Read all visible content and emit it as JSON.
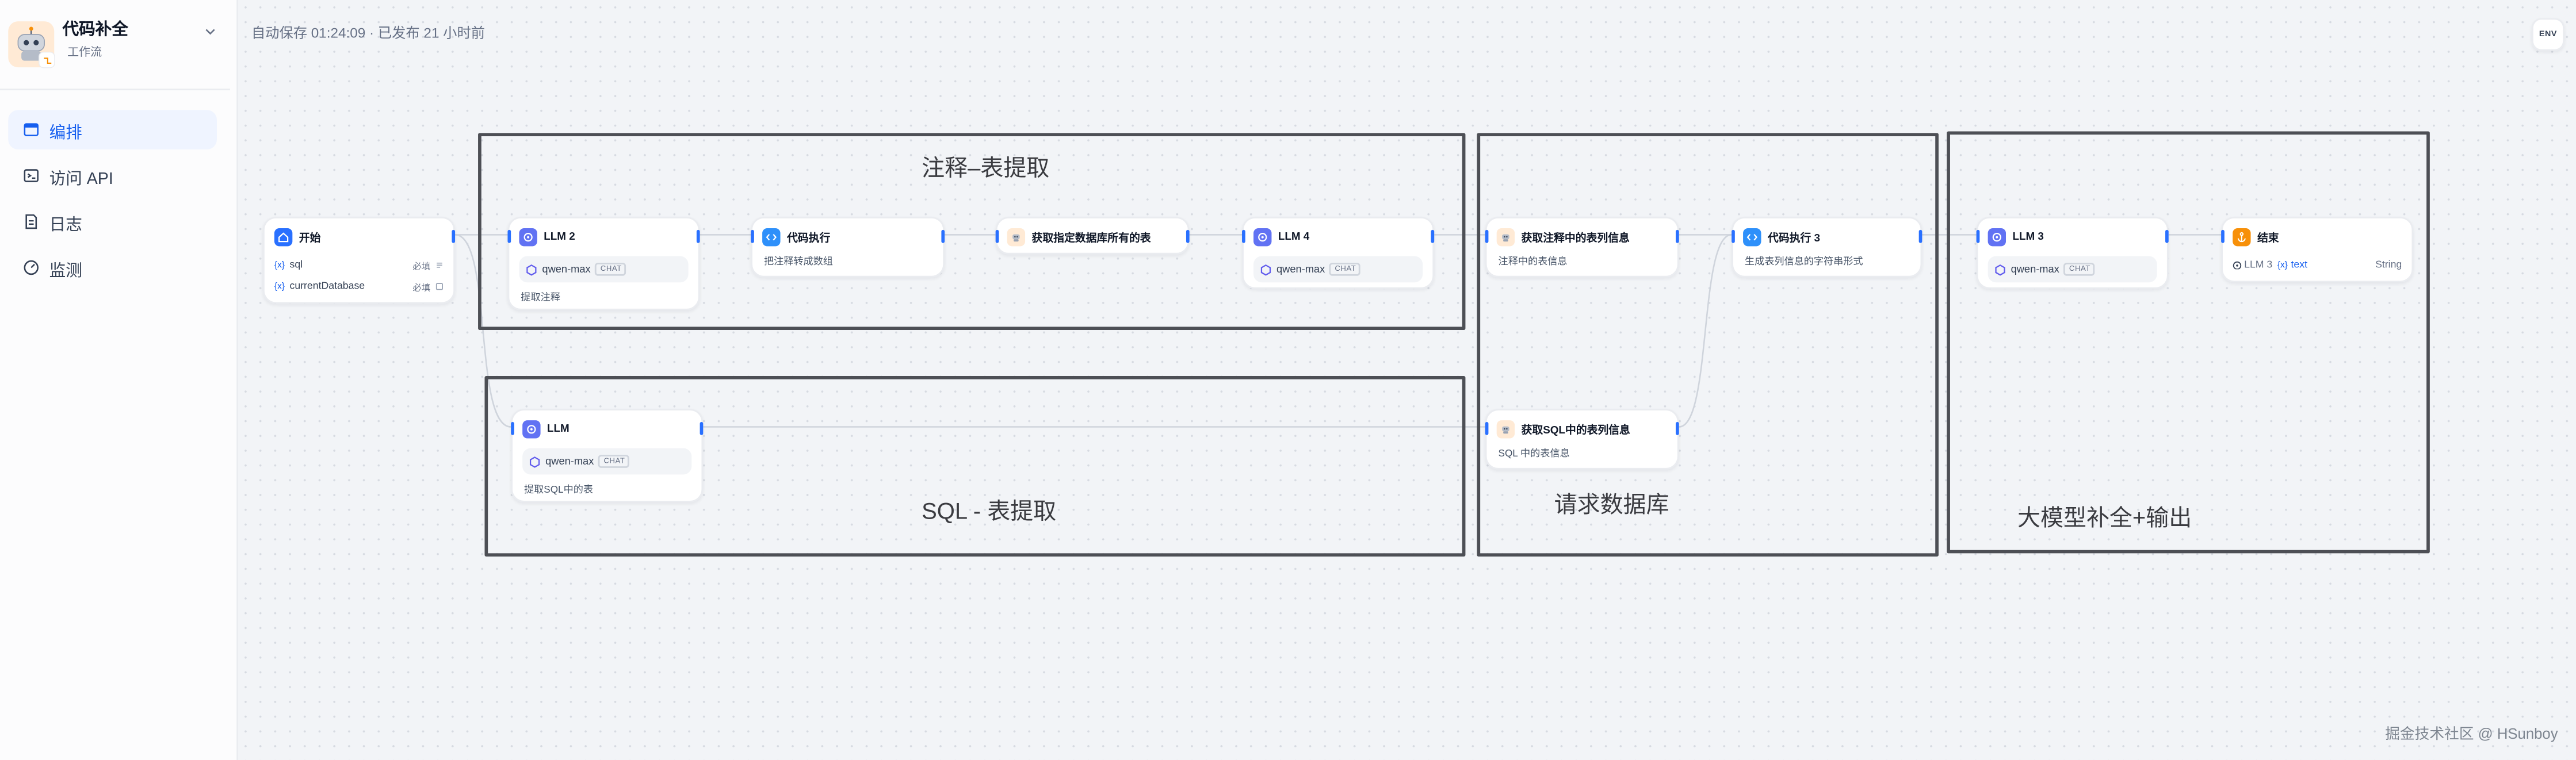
{
  "app": {
    "title": "代码补全",
    "type_tag": "工作流",
    "icon": "robot-app-icon"
  },
  "nav": {
    "items": [
      {
        "label": "编排",
        "icon": "layout-icon",
        "active": true
      },
      {
        "label": "访问 API",
        "icon": "terminal-icon",
        "active": false
      },
      {
        "label": "日志",
        "icon": "file-list-icon",
        "active": false
      },
      {
        "label": "监测",
        "icon": "gauge-icon",
        "active": false
      }
    ]
  },
  "header": {
    "status": "自动保存 01:24:09 · 已发布 21 小时前",
    "env_button": "ENV"
  },
  "groups": [
    {
      "label": "注释–表提取"
    },
    {
      "label": "SQL - 表提取"
    },
    {
      "label": "请求数据库"
    },
    {
      "label": "大模型补全+输出"
    }
  ],
  "var_glyph": "{x}",
  "nodes": {
    "start": {
      "title": "开始",
      "variables": [
        {
          "name": "sql",
          "required": "必填"
        },
        {
          "name": "currentDatabase",
          "required": "必填"
        }
      ]
    },
    "llm2": {
      "title": "LLM 2",
      "model": "qwen-max",
      "mode": "CHAT",
      "description": "提取注释"
    },
    "code1": {
      "title": "代码执行",
      "description": "把注释转成数组"
    },
    "tool_tables": {
      "title": "获取指定数据库所有的表"
    },
    "llm4": {
      "title": "LLM 4",
      "model": "qwen-max",
      "mode": "CHAT"
    },
    "tool_comment_cols": {
      "title": "获取注释中的表列信息",
      "description": "注释中的表信息"
    },
    "code3": {
      "title": "代码执行 3",
      "description": "生成表列信息的字符串形式"
    },
    "llm3": {
      "title": "LLM 3",
      "model": "qwen-max",
      "mode": "CHAT"
    },
    "end": {
      "title": "结束",
      "output": {
        "source": "LLM 3",
        "variable": "text",
        "type": "String"
      }
    },
    "llm": {
      "title": "LLM",
      "model": "qwen-max",
      "mode": "CHAT",
      "description": "提取SQL中的表"
    },
    "tool_sql_cols": {
      "title": "获取SQL中的表列信息",
      "description": "SQL 中的表信息"
    }
  },
  "watermark": "掘金技术社区 @ HSunboy",
  "colors": {
    "accent": "#155eef",
    "start_icon": "#2970ff",
    "llm_icon": "#6172f3",
    "code_icon": "#2e90fa",
    "end_icon": "#f79009",
    "group_border": "#4d4f55"
  }
}
